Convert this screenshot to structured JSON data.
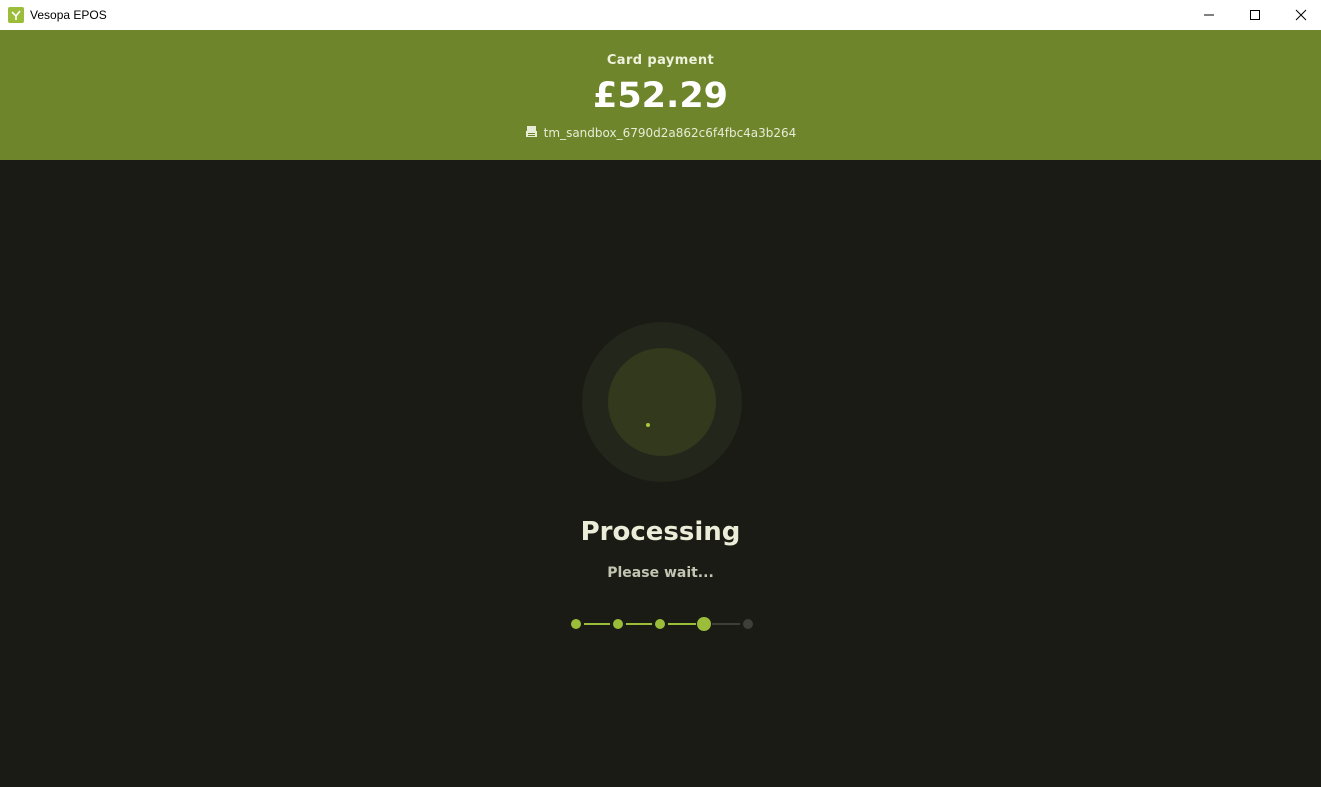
{
  "window": {
    "title": "Vesopa EPOS",
    "controls": [
      "minimize",
      "maximize",
      "close"
    ]
  },
  "payment": {
    "label": "Card payment",
    "amount": "£52.29",
    "terminal_id": "tm_sandbox_6790d2a862c6f4fbc4a3b264"
  },
  "status": {
    "title": "Processing",
    "subtitle": "Please wait..."
  },
  "progress": {
    "total_steps": 5,
    "completed_steps": 3,
    "current_step": 4
  },
  "colors": {
    "header_bg": "#6e852b",
    "main_bg": "#1a1b14",
    "accent": "#9bbd3a",
    "inactive": "#3e3f36"
  },
  "icons": {
    "app": "vesopa-logo-icon",
    "terminal": "card-terminal-icon"
  }
}
